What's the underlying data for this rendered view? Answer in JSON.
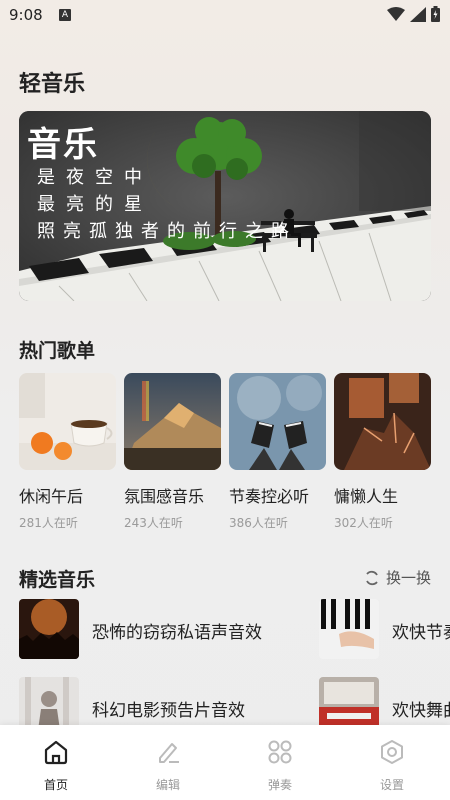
{
  "status": {
    "time": "9:08",
    "notif_letter": "A"
  },
  "app": {
    "title": "轻音乐"
  },
  "banner": {
    "title": "音乐",
    "lines": [
      "是夜空中",
      "最亮的星",
      "照亮孤独者的前行之路"
    ]
  },
  "hot_playlists": {
    "title": "热门歌单",
    "items": [
      {
        "name": "休闲午后",
        "listeners": "281人在听"
      },
      {
        "name": "氛围感音乐",
        "listeners": "243人在听"
      },
      {
        "name": "节奏控必听",
        "listeners": "386人在听"
      },
      {
        "name": "慵懒人生",
        "listeners": "302人在听"
      }
    ]
  },
  "featured": {
    "title": "精选音乐",
    "refresh_label": "换一换",
    "tracks": [
      {
        "name": "恐怖的窃窃私语声音效"
      },
      {
        "name": "欢快节奏"
      },
      {
        "name": "科幻电影预告片音效"
      },
      {
        "name": "欢快舞曲"
      }
    ]
  },
  "tabs": [
    {
      "label": "首页",
      "icon": "home-icon",
      "active": true
    },
    {
      "label": "编辑",
      "icon": "edit-icon",
      "active": false
    },
    {
      "label": "弹奏",
      "icon": "grid-icon",
      "active": false
    },
    {
      "label": "设置",
      "icon": "settings-icon",
      "active": false
    }
  ],
  "colors": {
    "active_tab": "#222222",
    "inactive_tab": "#999999",
    "accent_moon": "#f5d000"
  }
}
